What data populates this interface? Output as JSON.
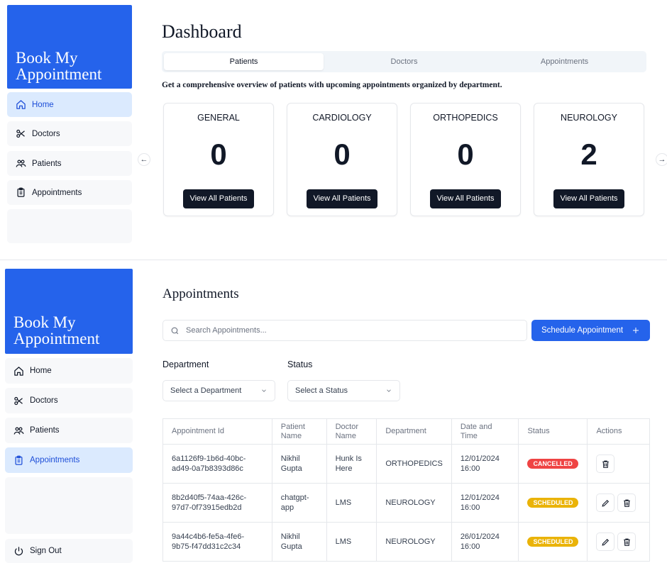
{
  "brand": {
    "line1": "Book My",
    "line2": "Appointment"
  },
  "nav": {
    "home": "Home",
    "doctors": "Doctors",
    "patients": "Patients",
    "appointments": "Appointments",
    "sign_out": "Sign Out"
  },
  "dashboard": {
    "title": "Dashboard",
    "tabs": [
      "Patients",
      "Doctors",
      "Appointments"
    ],
    "active_tab": "Patients",
    "description": "Get a comprehensive overview of patients with upcoming appointments organized by department.",
    "cards": [
      {
        "department": "GENERAL",
        "count": "0",
        "button": "View All Patients"
      },
      {
        "department": "CARDIOLOGY",
        "count": "0",
        "button": "View All Patients"
      },
      {
        "department": "ORTHOPEDICS",
        "count": "0",
        "button": "View All Patients"
      },
      {
        "department": "NEUROLOGY",
        "count": "2",
        "button": "View All Patients"
      }
    ],
    "prev_arrow": "←",
    "next_arrow": "→"
  },
  "appointments": {
    "title": "Appointments",
    "search_placeholder": "Search Appointments...",
    "schedule_button": "Schedule Appointment",
    "filters": {
      "department_label": "Department",
      "department_placeholder": "Select a Department",
      "status_label": "Status",
      "status_placeholder": "Select a Status"
    },
    "table": {
      "headers": [
        "Appointment Id",
        "Patient Name",
        "Doctor Name",
        "Department",
        "Date and Time",
        "Status",
        "Actions"
      ],
      "rows": [
        {
          "id": "6a1126f9-1b6d-40bc-ad49-0a7b8393d86c",
          "patient": "Nikhil Gupta",
          "doctor": "Hunk Is Here",
          "department": "ORTHOPEDICS",
          "datetime": "12/01/2024 16:00",
          "status": "CANCELLED"
        },
        {
          "id": "8b2d40f5-74aa-426c-97d7-0f73915edb2d",
          "patient": "chatgpt-app",
          "doctor": "LMS",
          "department": "NEUROLOGY",
          "datetime": "12/01/2024 16:00",
          "status": "SCHEDULED"
        },
        {
          "id": "9a44c4b6-fe5a-4fe6-9b75-f47dd31c2c34",
          "patient": "Nikhil Gupta",
          "doctor": "LMS",
          "department": "NEUROLOGY",
          "datetime": "26/01/2024 16:00",
          "status": "SCHEDULED"
        }
      ]
    }
  },
  "colors": {
    "brand": "#2563eb",
    "active_nav": "#dbeafe",
    "cancelled": "#ef4444",
    "scheduled": "#eab308",
    "dark_button": "#111827"
  }
}
